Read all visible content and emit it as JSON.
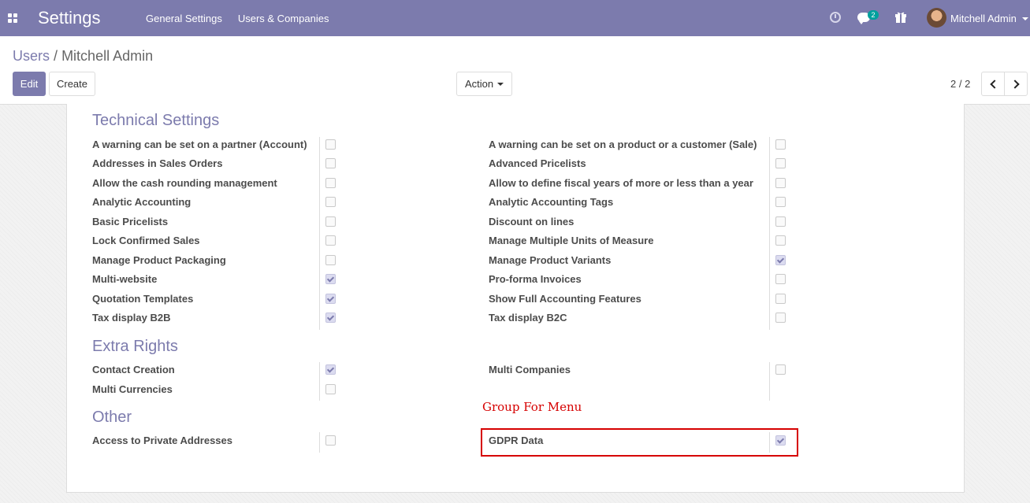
{
  "navbar": {
    "app_title": "Settings",
    "menu": [
      "General Settings",
      "Users & Companies"
    ],
    "chat_count": "2",
    "user_name": "Mitchell Admin"
  },
  "breadcrumb": {
    "parent": "Users",
    "separator": "/",
    "current": "Mitchell Admin"
  },
  "toolbar": {
    "edit_label": "Edit",
    "create_label": "Create",
    "action_label": "Action"
  },
  "pager": {
    "value": "2 / 2"
  },
  "sections": {
    "technical": {
      "title": "Technical Settings",
      "left": [
        {
          "label": "A warning can be set on a partner (Account)",
          "checked": false
        },
        {
          "label": "Addresses in Sales Orders",
          "checked": false
        },
        {
          "label": "Allow the cash rounding management",
          "checked": false
        },
        {
          "label": "Analytic Accounting",
          "checked": false
        },
        {
          "label": "Basic Pricelists",
          "checked": false
        },
        {
          "label": "Lock Confirmed Sales",
          "checked": false
        },
        {
          "label": "Manage Product Packaging",
          "checked": false
        },
        {
          "label": "Multi-website",
          "checked": true
        },
        {
          "label": "Quotation Templates",
          "checked": true
        },
        {
          "label": "Tax display B2B",
          "checked": true
        }
      ],
      "right": [
        {
          "label": "A warning can be set on a product or a customer (Sale)",
          "checked": false
        },
        {
          "label": "Advanced Pricelists",
          "checked": false
        },
        {
          "label": "Allow to define fiscal years of more or less than a year",
          "checked": false
        },
        {
          "label": "Analytic Accounting Tags",
          "checked": false
        },
        {
          "label": "Discount on lines",
          "checked": false
        },
        {
          "label": "Manage Multiple Units of Measure",
          "checked": false
        },
        {
          "label": "Manage Product Variants",
          "checked": true
        },
        {
          "label": "Pro-forma Invoices",
          "checked": false
        },
        {
          "label": "Show Full Accounting Features",
          "checked": false
        },
        {
          "label": "Tax display B2C",
          "checked": false
        }
      ]
    },
    "extra": {
      "title": "Extra Rights",
      "left": [
        {
          "label": "Contact Creation",
          "checked": true
        },
        {
          "label": "Multi Currencies",
          "checked": false
        }
      ],
      "right": [
        {
          "label": "Multi Companies",
          "checked": false
        }
      ]
    },
    "other": {
      "title": "Other",
      "left": [
        {
          "label": "Access to Private Addresses",
          "checked": false
        }
      ],
      "right": [
        {
          "label": "GDPR Data",
          "checked": true
        }
      ]
    }
  },
  "annotation": {
    "text": "Group For Menu",
    "color": "#d60000"
  },
  "colors": {
    "brand": "#7c7bad",
    "badge": "#00a09d"
  }
}
